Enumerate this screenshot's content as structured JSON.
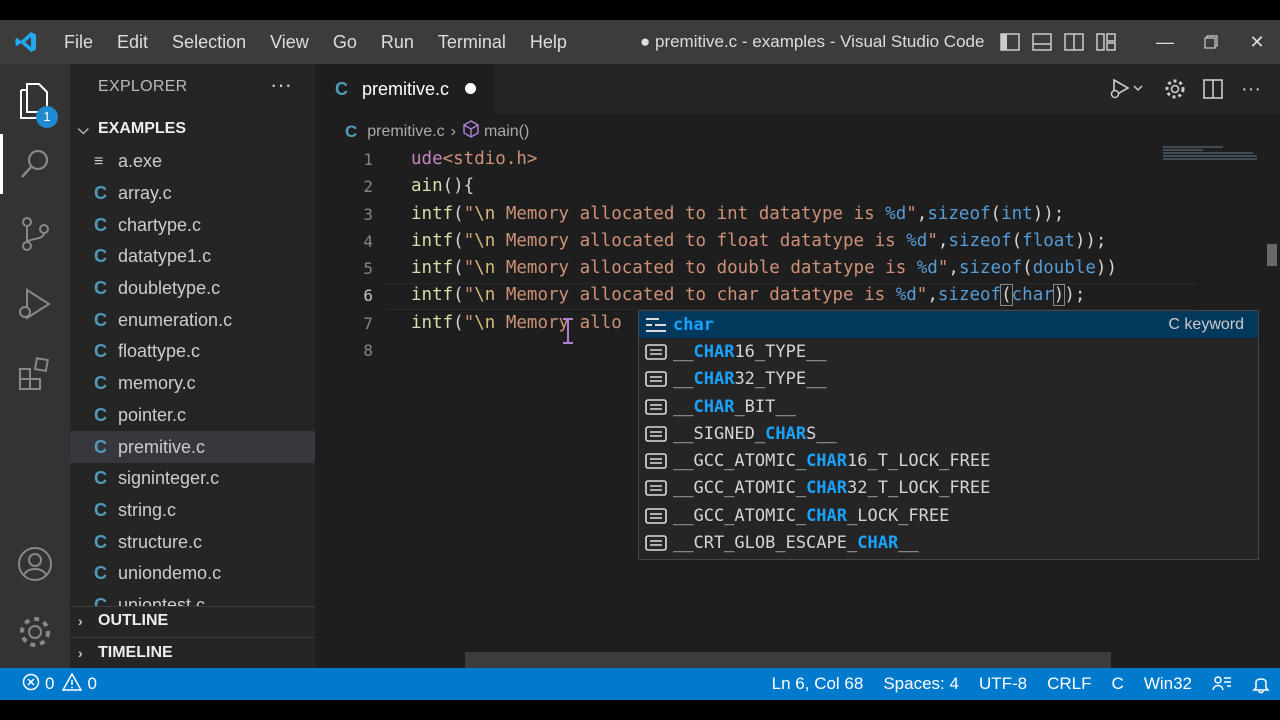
{
  "window": {
    "title": "● premitive.c - examples - Visual Studio Code",
    "menu": [
      "File",
      "Edit",
      "Selection",
      "View",
      "Go",
      "Run",
      "Terminal",
      "Help"
    ]
  },
  "activity": {
    "explorer_badge": "1"
  },
  "sidebar": {
    "header": "EXPLORER",
    "more": "···",
    "folder": "EXAMPLES",
    "files": [
      {
        "name": "a.exe",
        "type": "exe"
      },
      {
        "name": "array.c",
        "type": "c"
      },
      {
        "name": "chartype.c",
        "type": "c"
      },
      {
        "name": "datatype1.c",
        "type": "c"
      },
      {
        "name": "doubletype.c",
        "type": "c"
      },
      {
        "name": "enumeration.c",
        "type": "c"
      },
      {
        "name": "floattype.c",
        "type": "c"
      },
      {
        "name": "memory.c",
        "type": "c"
      },
      {
        "name": "pointer.c",
        "type": "c"
      },
      {
        "name": "premitive.c",
        "type": "c",
        "selected": true
      },
      {
        "name": "signinteger.c",
        "type": "c"
      },
      {
        "name": "string.c",
        "type": "c"
      },
      {
        "name": "structure.c",
        "type": "c"
      },
      {
        "name": "uniondemo.c",
        "type": "c"
      },
      {
        "name": "uniontest.c",
        "type": "c"
      }
    ],
    "c_icon": "C",
    "exe_icon": "≡",
    "outline": "OUTLINE",
    "timeline": "TIMELINE"
  },
  "editor": {
    "tab_label": "premitive.c",
    "tab_icon": "C",
    "breadcrumb": {
      "file": "premitive.c",
      "symbol": "main()"
    },
    "line_numbers": [
      "1",
      "2",
      "3",
      "4",
      "5",
      "6",
      "7",
      "8"
    ],
    "current_line": 6
  },
  "suggest": {
    "items": [
      {
        "pre": "",
        "match": "char",
        "post": "",
        "detail": "C keyword"
      },
      {
        "pre": "__",
        "match": "CHAR",
        "post": "16_TYPE__",
        "detail": ""
      },
      {
        "pre": "__",
        "match": "CHAR",
        "post": "32_TYPE__",
        "detail": ""
      },
      {
        "pre": "__",
        "match": "CHAR",
        "post": "_BIT__",
        "detail": ""
      },
      {
        "pre": "__SIGNED_",
        "match": "CHAR",
        "post": "S__",
        "detail": ""
      },
      {
        "pre": "__GCC_ATOMIC_",
        "match": "CHAR",
        "post": "16_T_LOCK_FREE",
        "detail": ""
      },
      {
        "pre": "__GCC_ATOMIC_",
        "match": "CHAR",
        "post": "32_T_LOCK_FREE",
        "detail": ""
      },
      {
        "pre": "__GCC_ATOMIC_",
        "match": "CHAR",
        "post": "_LOCK_FREE",
        "detail": ""
      },
      {
        "pre": "__CRT_GLOB_ESCAPE_",
        "match": "CHAR",
        "post": "__",
        "detail": ""
      }
    ]
  },
  "status": {
    "errors": "0",
    "warnings": "0",
    "position": "Ln 6, Col 68",
    "spaces": "Spaces: 4",
    "encoding": "UTF-8",
    "eol": "CRLF",
    "language": "C",
    "platform": "Win32"
  },
  "colors": {
    "statusbar": "#007acc",
    "accent_match": "#18a3ff",
    "c_icon": "#519aba"
  }
}
